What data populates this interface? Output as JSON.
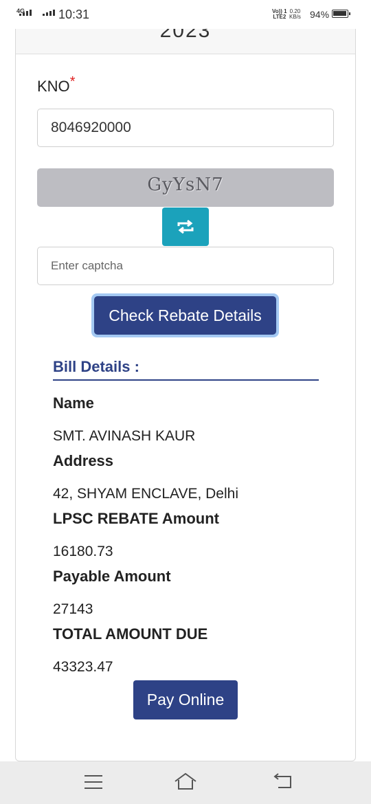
{
  "status_bar": {
    "network": "4G",
    "time": "10:31",
    "volte_line1": "Vo)) 1",
    "volte_line2": "LTE2",
    "speed_value": "0.20",
    "speed_unit": "KB/s",
    "battery": "94%"
  },
  "header": {
    "title_partial": "2023"
  },
  "form": {
    "kno_label": "KNO",
    "required_mark": "*",
    "kno_value": "8046920000",
    "captcha_text": "GyYsN7",
    "captcha_placeholder": "Enter captcha",
    "refresh_icon": "refresh-icon",
    "check_button": "Check Rebate Details"
  },
  "bill": {
    "title": "Bill Details :",
    "fields": [
      {
        "label": "Name",
        "value": "SMT. AVINASH KAUR"
      },
      {
        "label": "Address",
        "value": "42, SHYAM ENCLAVE, Delhi"
      },
      {
        "label": "LPSC REBATE Amount",
        "value": "16180.73"
      },
      {
        "label": "Payable Amount",
        "value": "27143"
      },
      {
        "label": "TOTAL AMOUNT DUE",
        "value": "43323.47"
      }
    ],
    "pay_button": "Pay Online"
  },
  "nav": {
    "icons": [
      "menu-icon",
      "home-icon",
      "back-icon"
    ]
  },
  "colors": {
    "primary": "#2e4286",
    "accent": "#1ba2bb",
    "required": "#e02020",
    "captcha_bg": "#bdbdc2"
  }
}
